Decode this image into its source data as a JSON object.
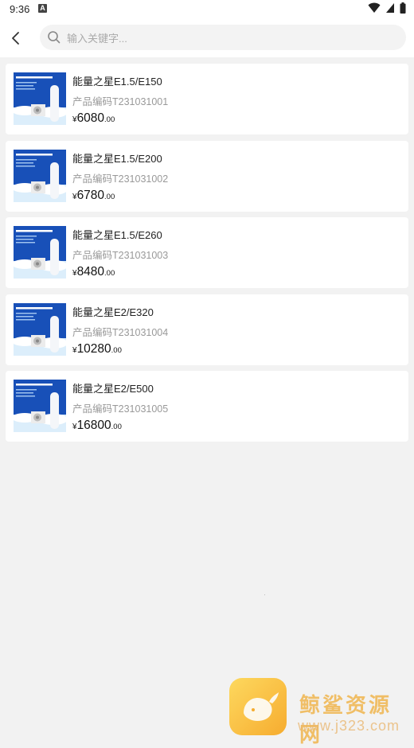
{
  "status_bar": {
    "time": "9:36",
    "notification_letter": "A"
  },
  "search": {
    "placeholder": "输入关键字..."
  },
  "products": [
    {
      "title": "能量之星E1.5/E150",
      "code": "产品编码T231031001",
      "currency": "¥",
      "price_int": "6080",
      "price_dec": ".00"
    },
    {
      "title": "能量之星E1.5/E200",
      "code": "产品编码T231031002",
      "currency": "¥",
      "price_int": "6780",
      "price_dec": ".00"
    },
    {
      "title": "能量之星E1.5/E260",
      "code": "产品编码T231031003",
      "currency": "¥",
      "price_int": "8480",
      "price_dec": ".00"
    },
    {
      "title": "能量之星E2/E320",
      "code": "产品编码T231031004",
      "currency": "¥",
      "price_int": "10280",
      "price_dec": ".00"
    },
    {
      "title": "能量之星E2/E500",
      "code": "产品编码T231031005",
      "currency": "¥",
      "price_int": "16800",
      "price_dec": ".00"
    }
  ],
  "watermark": {
    "name": "鲸鲨资源网",
    "url": "www.j323.com"
  },
  "colors": {
    "background": "#f2f2f2",
    "card": "#ffffff",
    "thumb_blue": "#1850b8"
  },
  "icons": {
    "back": "chevron-left-icon",
    "search": "search-icon",
    "wifi": "wifi-icon",
    "signal": "signal-icon",
    "battery": "battery-icon"
  }
}
